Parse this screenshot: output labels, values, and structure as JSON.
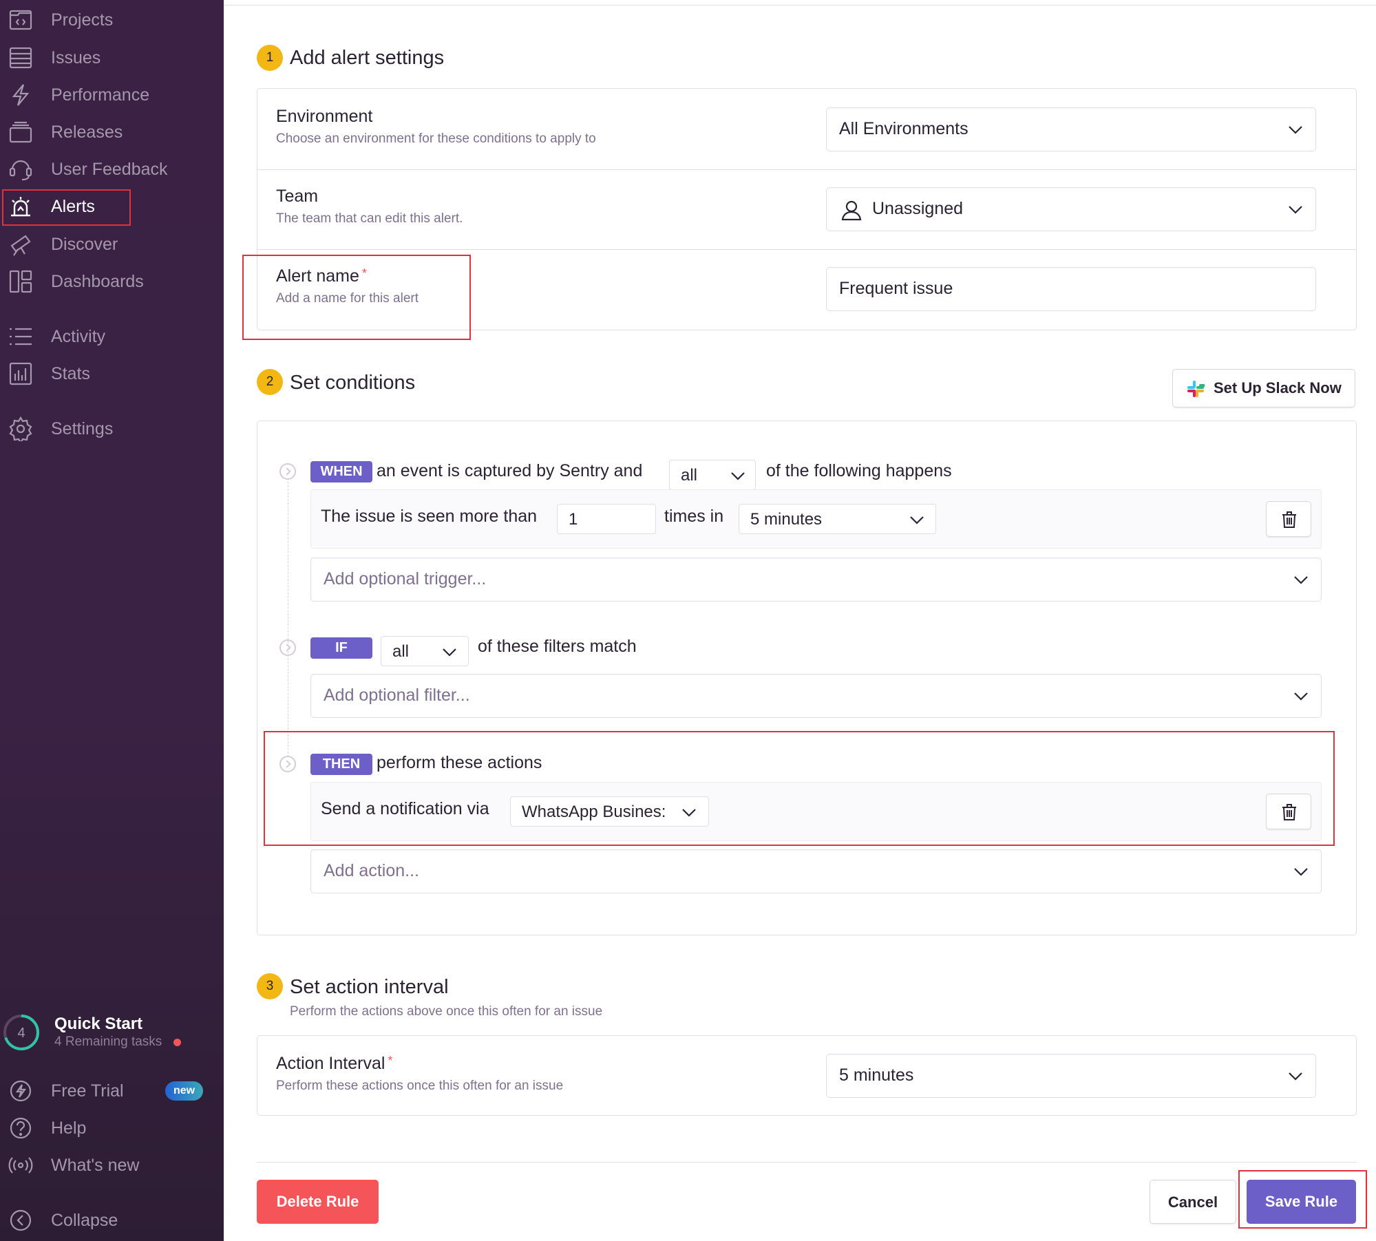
{
  "sidebar": {
    "items": [
      {
        "label": "Projects",
        "icon": "projects-icon"
      },
      {
        "label": "Issues",
        "icon": "issues-icon"
      },
      {
        "label": "Performance",
        "icon": "performance-icon"
      },
      {
        "label": "Releases",
        "icon": "releases-icon"
      },
      {
        "label": "User Feedback",
        "icon": "user-feedback-icon"
      },
      {
        "label": "Alerts",
        "icon": "siren-icon",
        "active": true
      },
      {
        "label": "Discover",
        "icon": "telescope-icon"
      },
      {
        "label": "Dashboards",
        "icon": "dashboards-icon"
      },
      {
        "label": "Activity",
        "icon": "list-icon"
      },
      {
        "label": "Stats",
        "icon": "bar-chart-icon"
      },
      {
        "label": "Settings",
        "icon": "gear-icon"
      }
    ],
    "quick_start": {
      "count": "4",
      "title": "Quick Start",
      "subtitle": "4 Remaining tasks"
    },
    "bottom_items": [
      {
        "label": "Free Trial",
        "icon": "lightning-icon",
        "badge": "new"
      },
      {
        "label": "Help",
        "icon": "question-icon"
      },
      {
        "label": "What's new",
        "icon": "broadcast-icon"
      },
      {
        "label": "Collapse",
        "icon": "collapse-icon"
      }
    ]
  },
  "step1": {
    "number": "1",
    "title": "Add alert settings",
    "environment": {
      "label": "Environment",
      "help": "Choose an environment for these conditions to apply to",
      "value": "All Environments"
    },
    "team": {
      "label": "Team",
      "help": "The team that can edit this alert.",
      "value": "Unassigned"
    },
    "alert_name": {
      "label": "Alert name",
      "required": "*",
      "help": "Add a name for this alert",
      "value": "Frequent issue"
    }
  },
  "step2": {
    "number": "2",
    "title": "Set conditions",
    "slack_button": "Set Up Slack Now",
    "when": {
      "pill": "WHEN",
      "text_before": "an event is captured by Sentry and",
      "match": "all",
      "text_after": "of the following happens",
      "condition": {
        "text": "The issue is seen more than",
        "count": "1",
        "text_mid": "times in",
        "interval": "5 minutes"
      },
      "add_placeholder": "Add optional trigger..."
    },
    "if": {
      "pill": "IF",
      "match": "all",
      "text_after": "of these filters match",
      "add_placeholder": "Add optional filter..."
    },
    "then": {
      "pill": "THEN",
      "text_after": "perform these actions",
      "action": {
        "text": "Send a notification via",
        "integration": "WhatsApp Busines:"
      },
      "add_placeholder": "Add action..."
    }
  },
  "step3": {
    "number": "3",
    "title": "Set action interval",
    "subtitle": "Perform the actions above once this often for an issue",
    "interval": {
      "label": "Action Interval",
      "required": "*",
      "help": "Perform these actions once this often for an issue",
      "value": "5 minutes"
    }
  },
  "footer": {
    "delete": "Delete Rule",
    "cancel": "Cancel",
    "save": "Save Rule"
  },
  "colors": {
    "sidebar_bg": "#3b2244",
    "accent": "#6c5fc7",
    "step_badge": "#f2b712",
    "danger": "#f55459",
    "highlight": "#e0313c"
  }
}
